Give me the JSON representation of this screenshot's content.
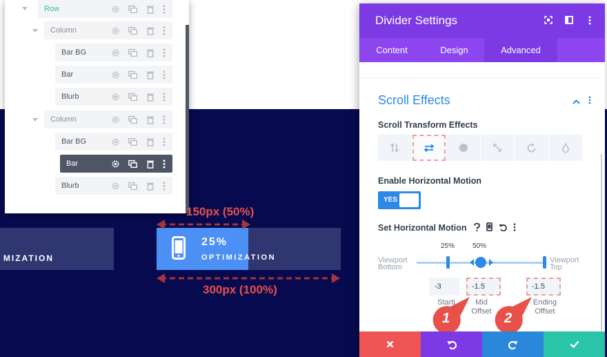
{
  "layers": {
    "items": [
      {
        "label": "Row"
      },
      {
        "label": "Column"
      },
      {
        "label": "Bar BG"
      },
      {
        "label": "Bar"
      },
      {
        "label": "Blurb"
      },
      {
        "label": "Column"
      },
      {
        "label": "Bar BG"
      },
      {
        "label": "Bar"
      },
      {
        "label": "Blurb"
      }
    ]
  },
  "canvas": {
    "left_bar_text": "MIZATION",
    "percent": "25%",
    "optimization": "OPTIMIZATION",
    "annotation_top": "150px (50%)",
    "annotation_bottom": "300px (100%)"
  },
  "modal": {
    "title": "Divider Settings",
    "tabs": [
      "Content",
      "Design",
      "Advanced"
    ],
    "active_tab": "Advanced",
    "section_title": "Scroll Effects",
    "transform_label": "Scroll Transform Effects",
    "enable_label": "Enable Horizontal Motion",
    "toggle_text": "YES",
    "set_motion_label": "Set Horizontal Motion",
    "viewport_bottom": [
      "Viewport",
      "Bottom"
    ],
    "viewport_top": [
      "Viewport",
      "Top"
    ],
    "pct_25": "25%",
    "pct_50": "50%",
    "start_value": "-3",
    "mid_value": "-1.5",
    "end_value": "-1.5",
    "start_label": [
      "Starti",
      "O"
    ],
    "mid_label": [
      "Mid",
      "Offset"
    ],
    "end_label": [
      "Ending",
      "Offset"
    ],
    "marker_1": "1",
    "marker_2": "2"
  },
  "colors": {
    "purple_header": "#7b3ae4",
    "purple_tabs": "#8d46ef",
    "blue_accent": "#2c89e8",
    "navy_bg": "#070a4f",
    "annotation_red": "#e8504a",
    "footer_red": "#ef5555",
    "footer_purple": "#7b3ae4",
    "footer_blue": "#2b87da",
    "footer_green": "#29c4a9"
  }
}
